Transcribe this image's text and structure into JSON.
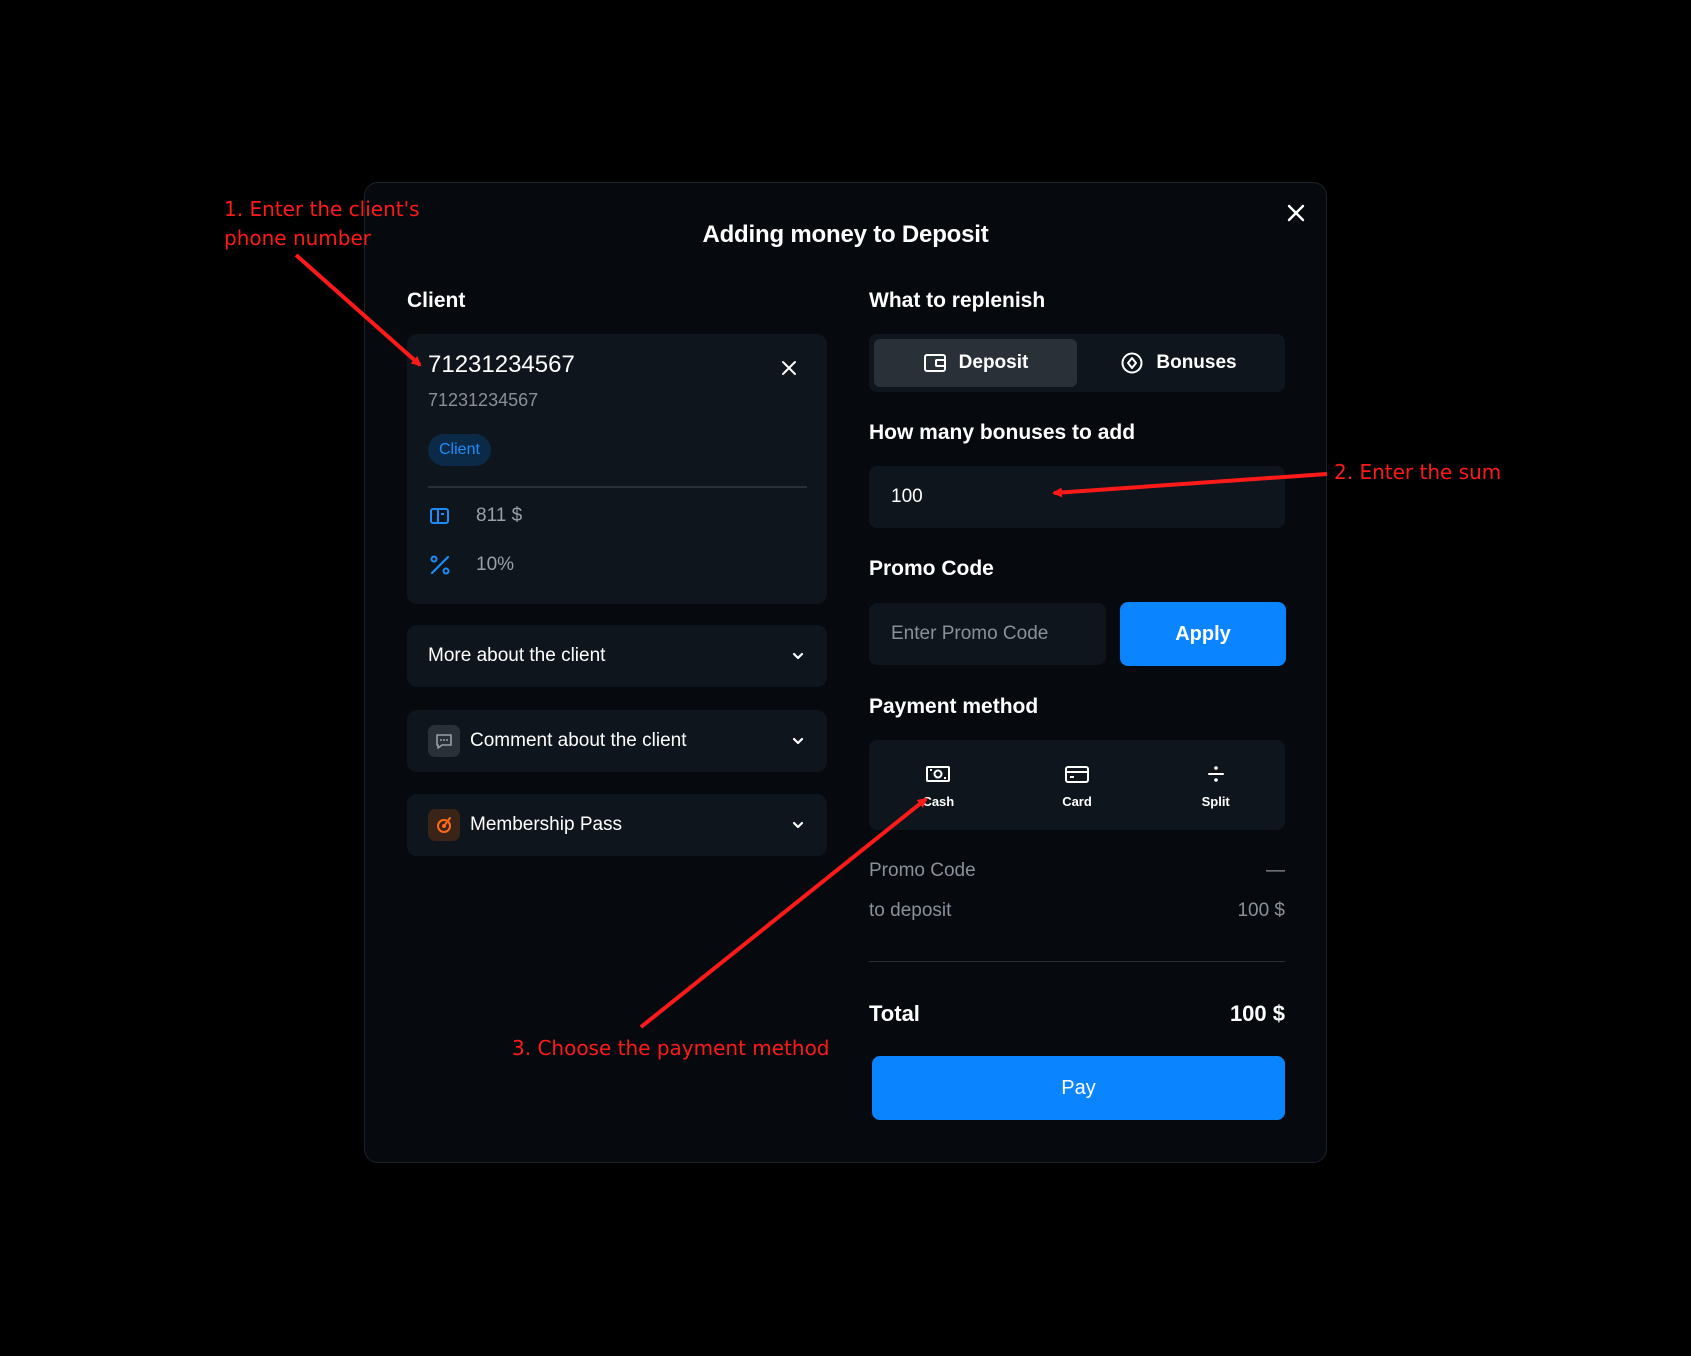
{
  "modal": {
    "title": "Adding money to Deposit"
  },
  "client": {
    "section_label": "Client",
    "name": "71231234567",
    "phone": "71231234567",
    "badge": "Client",
    "balance": "811 $",
    "discount": "10%"
  },
  "accordions": {
    "more_about": "More about the client",
    "comment": "Comment about the client",
    "membership": "Membership Pass"
  },
  "replenish": {
    "section_label": "What to replenish",
    "options": [
      {
        "label": "Deposit",
        "icon": "wallet-icon",
        "active": true
      },
      {
        "label": "Bonuses",
        "icon": "bonus-icon",
        "active": false
      }
    ]
  },
  "amount": {
    "label": "How many bonuses to add",
    "value": "100"
  },
  "promo": {
    "label": "Promo Code",
    "placeholder": "Enter Promo Code",
    "apply_label": "Apply"
  },
  "payment": {
    "label": "Payment method",
    "methods": [
      {
        "label": "Cash",
        "icon": "cash-icon"
      },
      {
        "label": "Card",
        "icon": "card-icon"
      },
      {
        "label": "Split",
        "icon": "divide-icon"
      }
    ]
  },
  "summary": {
    "promo_label": "Promo Code",
    "promo_value": "—",
    "deposit_label": "to deposit",
    "deposit_value": "100 $",
    "total_label": "Total",
    "total_value": "100 $",
    "pay_label": "Pay"
  },
  "annotations": {
    "step1_line1": "1. Enter the client's",
    "step1_line2": "phone number",
    "step2": "2. Enter the sum",
    "step3": "3. Choose the payment method"
  },
  "colors": {
    "accent": "#0a84ff",
    "annotation": "#ff1a1a",
    "panel": "#0e151c",
    "modal_bg": "#060a0f"
  }
}
